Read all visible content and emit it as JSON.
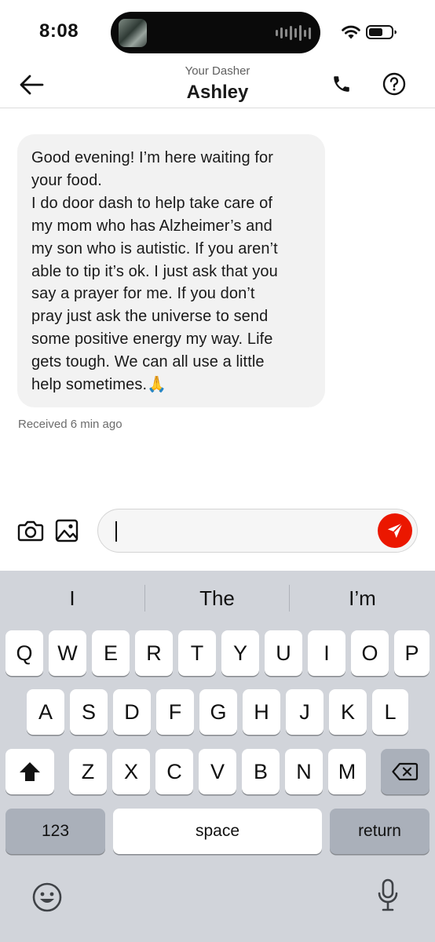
{
  "status_bar": {
    "time": "8:08",
    "icons": [
      "now-playing-artwork",
      "audio-waveform-icon",
      "wifi-icon",
      "battery-icon"
    ]
  },
  "header": {
    "subtitle": "Your Dasher",
    "title": "Ashley",
    "icons": [
      "back-arrow-icon",
      "phone-icon",
      "help-icon"
    ]
  },
  "conversation": {
    "message": "Good evening! I’m here waiting for\nyour food.\nI do door dash to help take care of\nmy mom who has Alzheimer’s and\nmy son who is autistic. If you aren’t\nable to tip it’s ok. I just ask that you\nsay a prayer for me. If you don’t\npray just ask the universe to send\nsome positive energy my way. Life\ngets tough. We can all use a little\nhelp sometimes.🙏",
    "received": "Received 6 min ago"
  },
  "composer": {
    "value": "",
    "icons": [
      "camera-icon",
      "image-icon",
      "send-icon"
    ],
    "send_color": "#EB1700"
  },
  "keyboard": {
    "suggestions": [
      "I",
      "The",
      "I’m"
    ],
    "row1": [
      "Q",
      "W",
      "E",
      "R",
      "T",
      "Y",
      "U",
      "I",
      "O",
      "P"
    ],
    "row2": [
      "A",
      "S",
      "D",
      "F",
      "G",
      "H",
      "J",
      "K",
      "L"
    ],
    "row3": [
      "Z",
      "X",
      "C",
      "V",
      "B",
      "N",
      "M"
    ],
    "numbers_label": "123",
    "space_label": "space",
    "return_label": "return",
    "icons": [
      "shift-icon",
      "delete-icon",
      "emoji-icon",
      "microphone-icon"
    ]
  }
}
